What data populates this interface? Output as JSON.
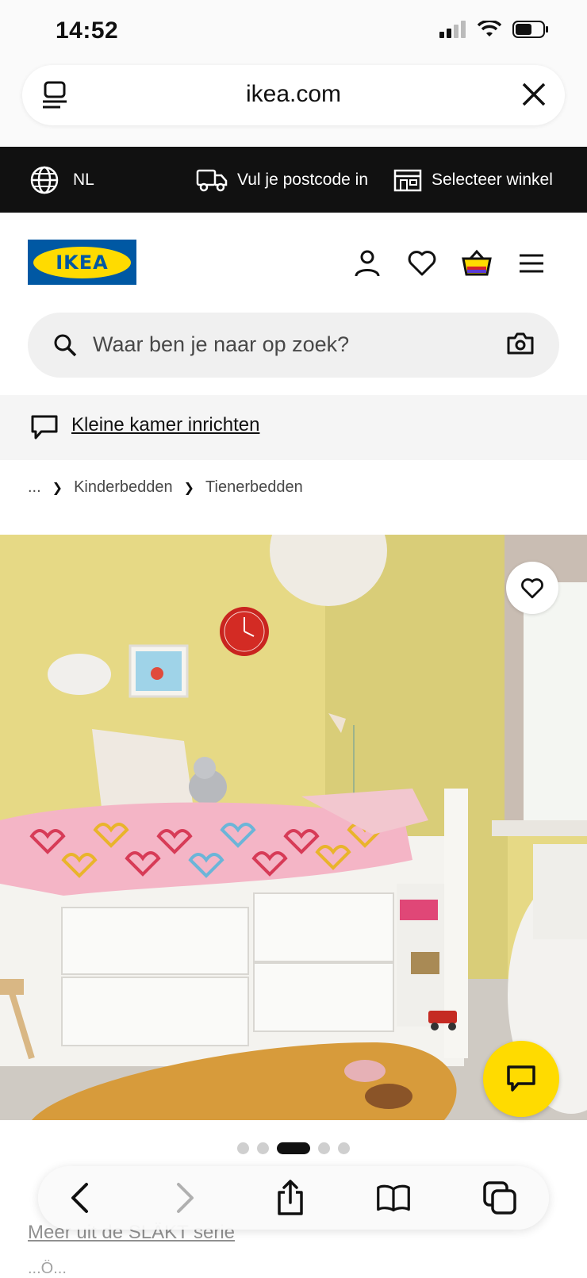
{
  "status_bar": {
    "time": "14:52"
  },
  "browser": {
    "url": "ikea.com"
  },
  "top_bar": {
    "language": "NL",
    "postcode_label": "Vul je postcode in",
    "store_label": "Selecteer winkel"
  },
  "header": {
    "logo_text": "IKEA"
  },
  "search": {
    "placeholder": "Waar ben je naar op zoek?"
  },
  "promo": {
    "link_text": "Kleine kamer inrichten"
  },
  "breadcrumb": {
    "ellipsis": "...",
    "items": [
      "Kinderbedden",
      "Tienerbedden"
    ]
  },
  "carousel": {
    "total": 5,
    "active_index": 2
  },
  "product": {
    "series_link": "Meer uit de SLÄKT serie",
    "peek_text": "...Ö..."
  },
  "colors": {
    "brand_blue": "#0058a3",
    "brand_yellow": "#ffdb00",
    "top_bar": "#111111"
  }
}
